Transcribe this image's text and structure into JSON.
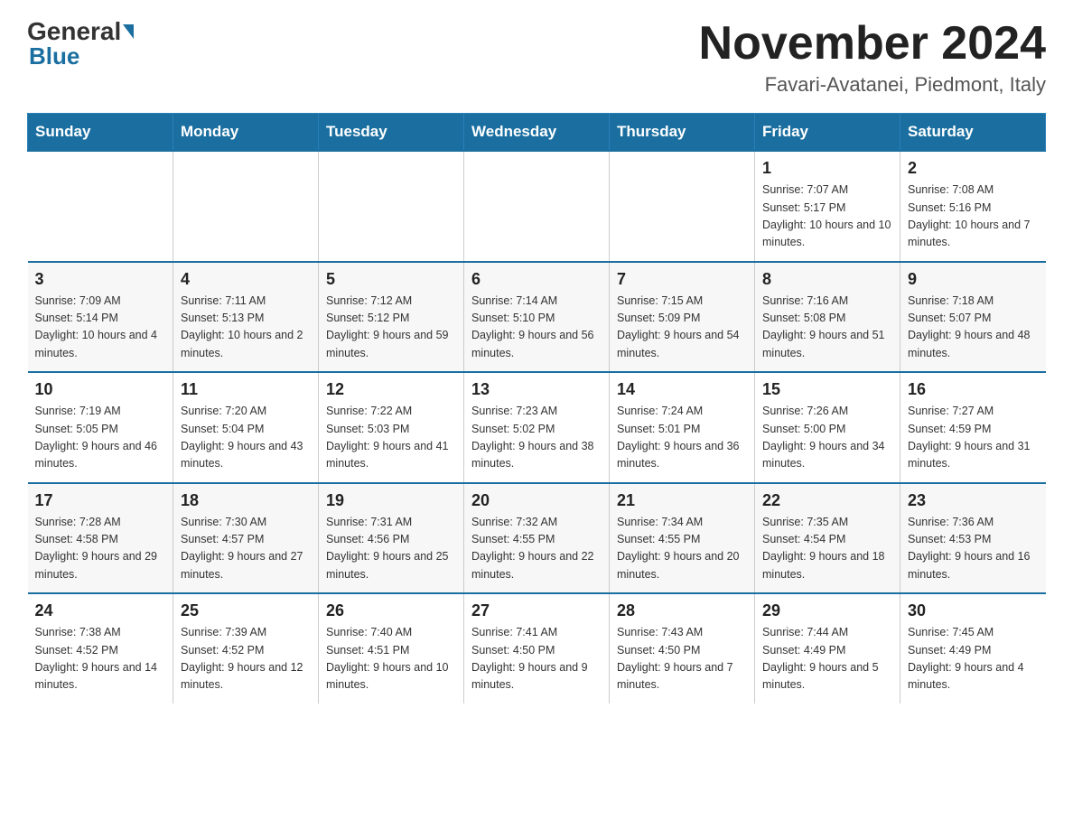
{
  "header": {
    "logo_general": "General",
    "logo_blue": "Blue",
    "month_title": "November 2024",
    "location": "Favari-Avatanei, Piedmont, Italy"
  },
  "days_of_week": [
    "Sunday",
    "Monday",
    "Tuesday",
    "Wednesday",
    "Thursday",
    "Friday",
    "Saturday"
  ],
  "weeks": [
    [
      {
        "day": "",
        "sunrise": "",
        "sunset": "",
        "daylight": ""
      },
      {
        "day": "",
        "sunrise": "",
        "sunset": "",
        "daylight": ""
      },
      {
        "day": "",
        "sunrise": "",
        "sunset": "",
        "daylight": ""
      },
      {
        "day": "",
        "sunrise": "",
        "sunset": "",
        "daylight": ""
      },
      {
        "day": "",
        "sunrise": "",
        "sunset": "",
        "daylight": ""
      },
      {
        "day": "1",
        "sunrise": "Sunrise: 7:07 AM",
        "sunset": "Sunset: 5:17 PM",
        "daylight": "Daylight: 10 hours and 10 minutes."
      },
      {
        "day": "2",
        "sunrise": "Sunrise: 7:08 AM",
        "sunset": "Sunset: 5:16 PM",
        "daylight": "Daylight: 10 hours and 7 minutes."
      }
    ],
    [
      {
        "day": "3",
        "sunrise": "Sunrise: 7:09 AM",
        "sunset": "Sunset: 5:14 PM",
        "daylight": "Daylight: 10 hours and 4 minutes."
      },
      {
        "day": "4",
        "sunrise": "Sunrise: 7:11 AM",
        "sunset": "Sunset: 5:13 PM",
        "daylight": "Daylight: 10 hours and 2 minutes."
      },
      {
        "day": "5",
        "sunrise": "Sunrise: 7:12 AM",
        "sunset": "Sunset: 5:12 PM",
        "daylight": "Daylight: 9 hours and 59 minutes."
      },
      {
        "day": "6",
        "sunrise": "Sunrise: 7:14 AM",
        "sunset": "Sunset: 5:10 PM",
        "daylight": "Daylight: 9 hours and 56 minutes."
      },
      {
        "day": "7",
        "sunrise": "Sunrise: 7:15 AM",
        "sunset": "Sunset: 5:09 PM",
        "daylight": "Daylight: 9 hours and 54 minutes."
      },
      {
        "day": "8",
        "sunrise": "Sunrise: 7:16 AM",
        "sunset": "Sunset: 5:08 PM",
        "daylight": "Daylight: 9 hours and 51 minutes."
      },
      {
        "day": "9",
        "sunrise": "Sunrise: 7:18 AM",
        "sunset": "Sunset: 5:07 PM",
        "daylight": "Daylight: 9 hours and 48 minutes."
      }
    ],
    [
      {
        "day": "10",
        "sunrise": "Sunrise: 7:19 AM",
        "sunset": "Sunset: 5:05 PM",
        "daylight": "Daylight: 9 hours and 46 minutes."
      },
      {
        "day": "11",
        "sunrise": "Sunrise: 7:20 AM",
        "sunset": "Sunset: 5:04 PM",
        "daylight": "Daylight: 9 hours and 43 minutes."
      },
      {
        "day": "12",
        "sunrise": "Sunrise: 7:22 AM",
        "sunset": "Sunset: 5:03 PM",
        "daylight": "Daylight: 9 hours and 41 minutes."
      },
      {
        "day": "13",
        "sunrise": "Sunrise: 7:23 AM",
        "sunset": "Sunset: 5:02 PM",
        "daylight": "Daylight: 9 hours and 38 minutes."
      },
      {
        "day": "14",
        "sunrise": "Sunrise: 7:24 AM",
        "sunset": "Sunset: 5:01 PM",
        "daylight": "Daylight: 9 hours and 36 minutes."
      },
      {
        "day": "15",
        "sunrise": "Sunrise: 7:26 AM",
        "sunset": "Sunset: 5:00 PM",
        "daylight": "Daylight: 9 hours and 34 minutes."
      },
      {
        "day": "16",
        "sunrise": "Sunrise: 7:27 AM",
        "sunset": "Sunset: 4:59 PM",
        "daylight": "Daylight: 9 hours and 31 minutes."
      }
    ],
    [
      {
        "day": "17",
        "sunrise": "Sunrise: 7:28 AM",
        "sunset": "Sunset: 4:58 PM",
        "daylight": "Daylight: 9 hours and 29 minutes."
      },
      {
        "day": "18",
        "sunrise": "Sunrise: 7:30 AM",
        "sunset": "Sunset: 4:57 PM",
        "daylight": "Daylight: 9 hours and 27 minutes."
      },
      {
        "day": "19",
        "sunrise": "Sunrise: 7:31 AM",
        "sunset": "Sunset: 4:56 PM",
        "daylight": "Daylight: 9 hours and 25 minutes."
      },
      {
        "day": "20",
        "sunrise": "Sunrise: 7:32 AM",
        "sunset": "Sunset: 4:55 PM",
        "daylight": "Daylight: 9 hours and 22 minutes."
      },
      {
        "day": "21",
        "sunrise": "Sunrise: 7:34 AM",
        "sunset": "Sunset: 4:55 PM",
        "daylight": "Daylight: 9 hours and 20 minutes."
      },
      {
        "day": "22",
        "sunrise": "Sunrise: 7:35 AM",
        "sunset": "Sunset: 4:54 PM",
        "daylight": "Daylight: 9 hours and 18 minutes."
      },
      {
        "day": "23",
        "sunrise": "Sunrise: 7:36 AM",
        "sunset": "Sunset: 4:53 PM",
        "daylight": "Daylight: 9 hours and 16 minutes."
      }
    ],
    [
      {
        "day": "24",
        "sunrise": "Sunrise: 7:38 AM",
        "sunset": "Sunset: 4:52 PM",
        "daylight": "Daylight: 9 hours and 14 minutes."
      },
      {
        "day": "25",
        "sunrise": "Sunrise: 7:39 AM",
        "sunset": "Sunset: 4:52 PM",
        "daylight": "Daylight: 9 hours and 12 minutes."
      },
      {
        "day": "26",
        "sunrise": "Sunrise: 7:40 AM",
        "sunset": "Sunset: 4:51 PM",
        "daylight": "Daylight: 9 hours and 10 minutes."
      },
      {
        "day": "27",
        "sunrise": "Sunrise: 7:41 AM",
        "sunset": "Sunset: 4:50 PM",
        "daylight": "Daylight: 9 hours and 9 minutes."
      },
      {
        "day": "28",
        "sunrise": "Sunrise: 7:43 AM",
        "sunset": "Sunset: 4:50 PM",
        "daylight": "Daylight: 9 hours and 7 minutes."
      },
      {
        "day": "29",
        "sunrise": "Sunrise: 7:44 AM",
        "sunset": "Sunset: 4:49 PM",
        "daylight": "Daylight: 9 hours and 5 minutes."
      },
      {
        "day": "30",
        "sunrise": "Sunrise: 7:45 AM",
        "sunset": "Sunset: 4:49 PM",
        "daylight": "Daylight: 9 hours and 4 minutes."
      }
    ]
  ]
}
